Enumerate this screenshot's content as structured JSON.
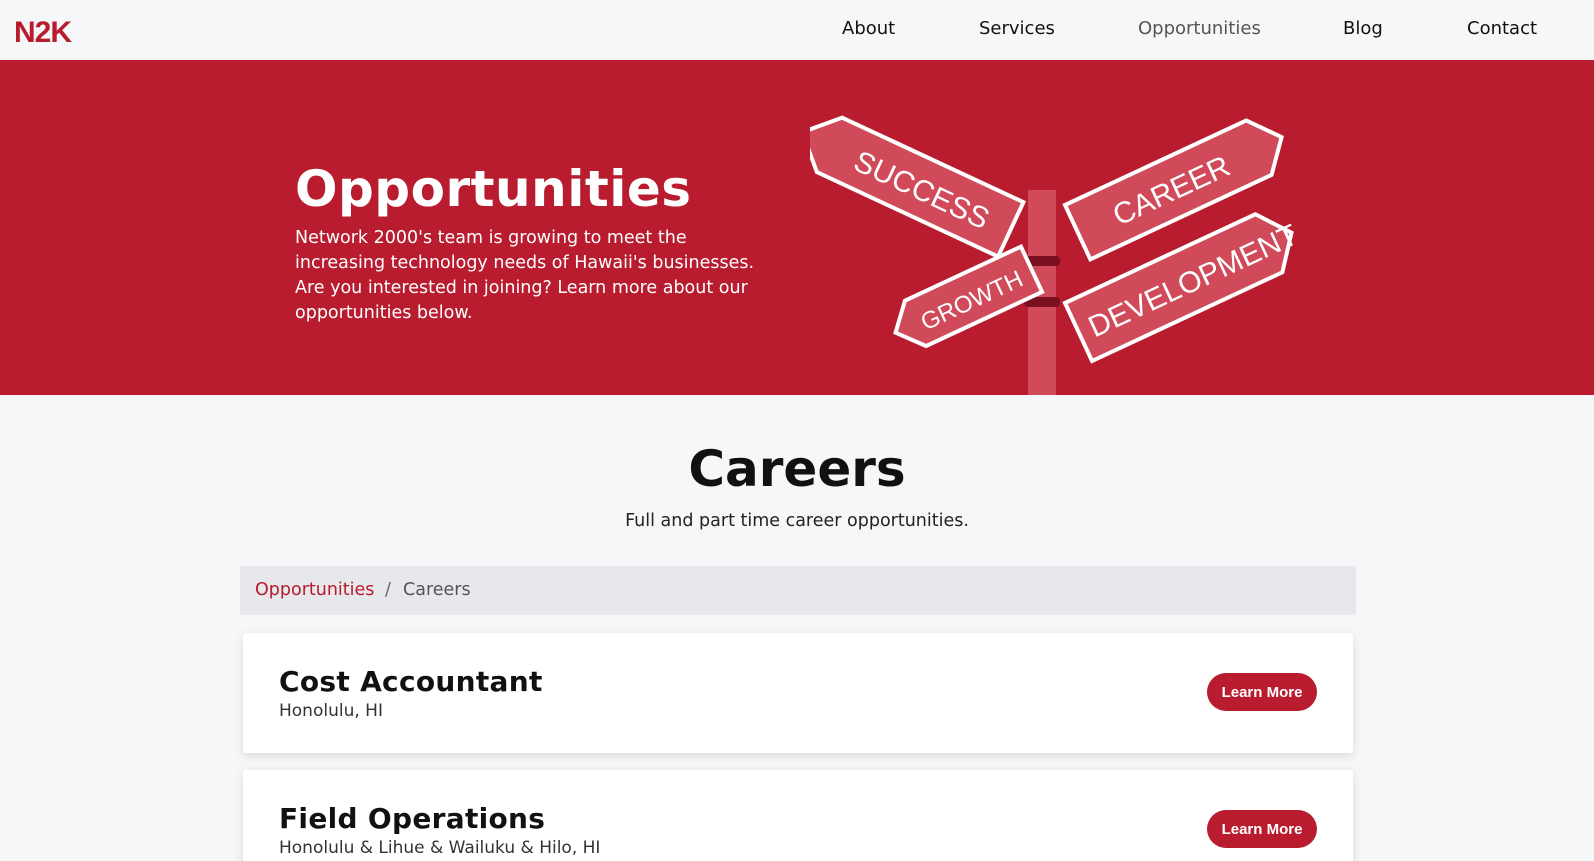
{
  "brand": {
    "logo_text": "N2K",
    "accent": "#b81c2e"
  },
  "nav": {
    "items": [
      {
        "label": "About"
      },
      {
        "label": "Services"
      },
      {
        "label": "Opportunities"
      },
      {
        "label": "Blog"
      },
      {
        "label": "Contact"
      }
    ]
  },
  "hero": {
    "title": "Opportunities",
    "text": "Network 2000's team is growing to meet the increasing technology needs of Hawaii's businesses. Are you interested in joining? Learn more about our opportunities below.",
    "signs": [
      "SUCCESS",
      "CAREER",
      "GROWTH",
      "DEVELOPMENT"
    ]
  },
  "careers": {
    "title": "Careers",
    "subtitle": "Full and part time career opportunities."
  },
  "breadcrumb": {
    "parent": "Opportunities",
    "separator": "/",
    "current": "Careers"
  },
  "jobs": [
    {
      "title": "Cost Accountant",
      "location": "Honolulu, HI",
      "button": "Learn More"
    },
    {
      "title": "Field Operations",
      "location": "Honolulu & Lihue & Wailuku & Hilo, HI",
      "button": "Learn More"
    }
  ]
}
